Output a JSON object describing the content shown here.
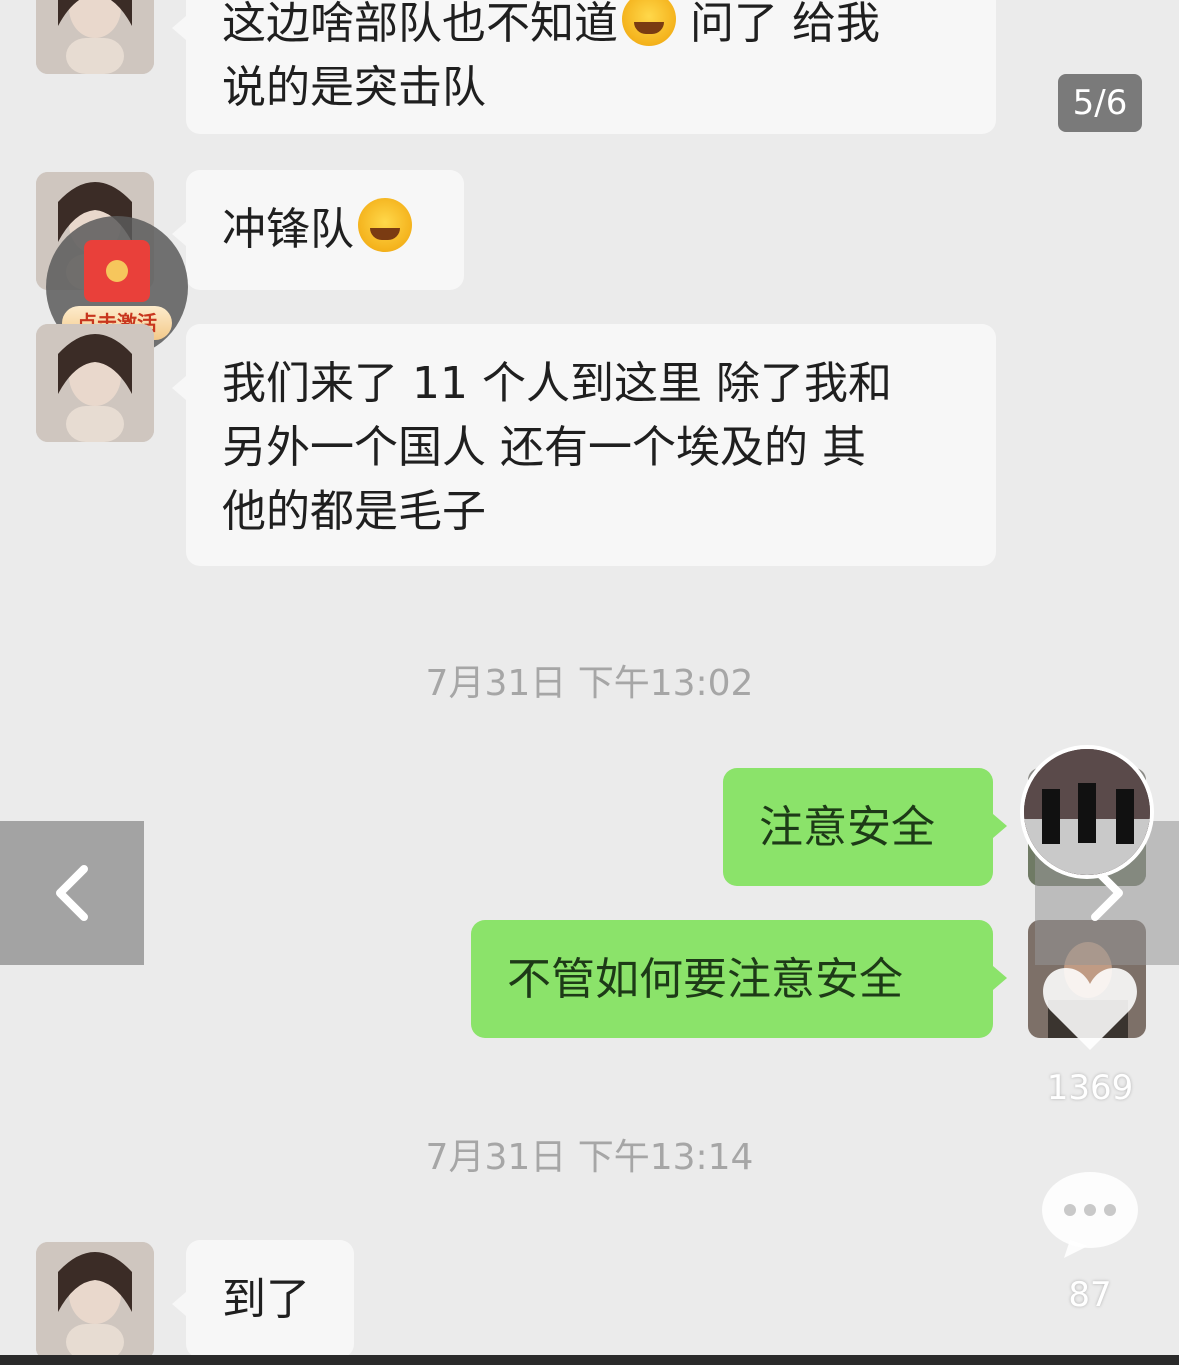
{
  "page_counter": "5/6",
  "messages": [
    {
      "direction": "in",
      "text": "这边啥部队也不知道",
      "text_after_emoji": " 问了 给我\n说的是突击队"
    },
    {
      "direction": "in",
      "text": "冲锋队"
    },
    {
      "direction": "in",
      "text": "我们来了 11 个人到这里 除了我和\n另外一个国人 还有一个埃及的 其\n他的都是毛子"
    },
    {
      "direction": "out",
      "text": "注意安全"
    },
    {
      "direction": "out",
      "text": "不管如何要注意安全"
    },
    {
      "direction": "in",
      "text": "到了"
    }
  ],
  "timestamps": [
    "7月31日 下午13:02",
    "7月31日 下午13:14"
  ],
  "red_packet": {
    "label": "点击激活"
  },
  "social": {
    "likes": "1369",
    "comments": "87"
  },
  "icons": [
    "laughing-crying-emoji",
    "chevron-left-icon",
    "chevron-right-icon",
    "heart-icon",
    "comment-icon"
  ]
}
